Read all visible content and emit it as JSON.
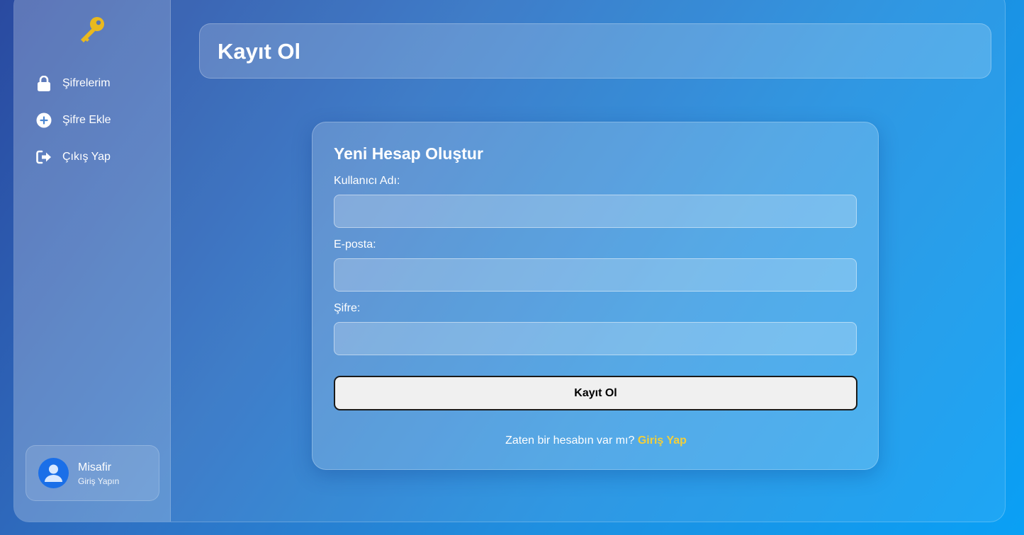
{
  "sidebar": {
    "logo_icon": "key-icon",
    "items": [
      {
        "label": "Şifrelerim",
        "icon": "lock-icon"
      },
      {
        "label": "Şifre Ekle",
        "icon": "plus-circle-icon"
      },
      {
        "label": "Çıkış Yap",
        "icon": "sign-out-icon"
      }
    ],
    "user": {
      "name": "Misafir",
      "subtitle": "Giriş Yapın",
      "icon": "user-icon"
    }
  },
  "header": {
    "title": "Kayıt Ol"
  },
  "form": {
    "title": "Yeni Hesap Oluştur",
    "username_label": "Kullanıcı Adı:",
    "username_value": "",
    "email_label": "E-posta:",
    "email_value": "",
    "password_label": "Şifre:",
    "password_value": "",
    "submit_label": "Kayıt Ol",
    "footer_text": "Zaten bir hesabın var mı?",
    "footer_link": "Giriş Yap"
  },
  "colors": {
    "accent": "#f2cf3a",
    "avatar": "#1a6fe8"
  }
}
